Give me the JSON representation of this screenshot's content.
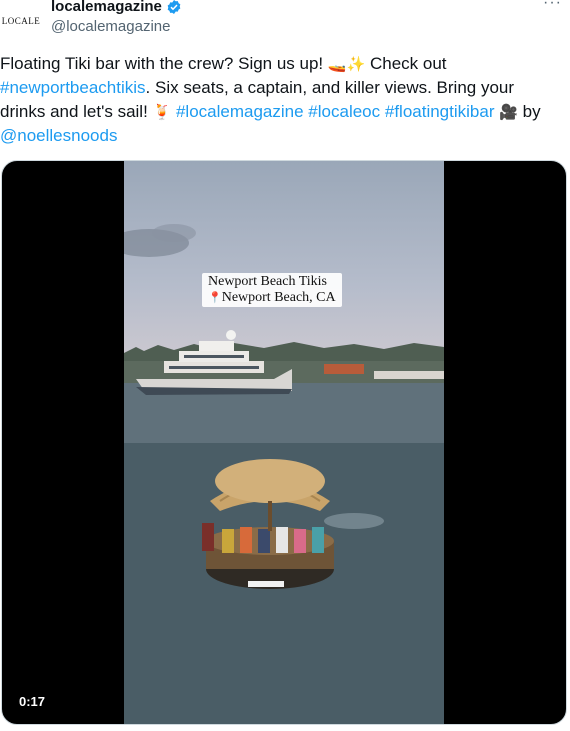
{
  "author": {
    "avatar_text": "LOCALE",
    "display_name": "localemagazine",
    "handle": "@localemagazine",
    "verified": true
  },
  "tweet": {
    "t1": "Floating Tiki bar with the crew? Sign us up! ",
    "e1": "🚤✨",
    "t2": " Check out ",
    "h1": "#newportbeachtikis",
    "t3": ". Six seats, a captain, and killer views. Bring your drinks and let's sail! ",
    "e2": "🍹",
    "t4": " ",
    "h2": "#localemagazine",
    "t5": " ",
    "h3": "#localeoc",
    "t6": " ",
    "h4": "#floatingtikibar",
    "t7": " ",
    "e3": "🎥",
    "t8": " by ",
    "m1": "@noellesnoods"
  },
  "media": {
    "overlay_line1": "Newport Beach Tikis",
    "overlay_pin": "📍",
    "overlay_line2": "Newport Beach, CA",
    "duration": "0:17"
  },
  "more_menu": "···",
  "colors": {
    "link": "#1d9bf0",
    "verified": "#1d9bf0",
    "secondary_text": "#536471"
  }
}
